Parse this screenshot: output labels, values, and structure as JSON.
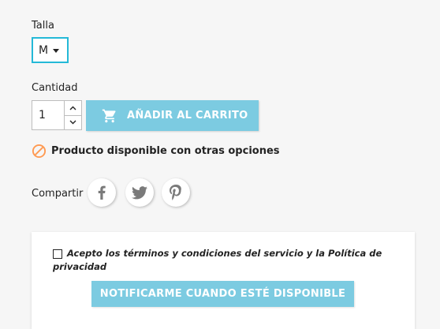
{
  "size": {
    "label": "Talla",
    "selected": "M"
  },
  "quantity": {
    "label": "Cantidad",
    "value": "1"
  },
  "cart": {
    "button_label": "AÑADIR AL CARRITO",
    "icon": "shopping-cart-icon"
  },
  "availability": {
    "text": "Producto disponible con otras opciones",
    "icon": "block-icon",
    "color": "#ff9a52"
  },
  "share": {
    "label": "Compartir",
    "networks": [
      "facebook",
      "twitter",
      "pinterest"
    ]
  },
  "notify": {
    "terms_text": "Acepto los términos y condiciones del servicio y la Política de privacidad",
    "button_label": "NOTIFICARME CUANDO ESTÉ DISPONIBLE"
  },
  "colors": {
    "accent": "#7ccbe1",
    "focus_border": "#24b9d7",
    "text": "#232323"
  }
}
